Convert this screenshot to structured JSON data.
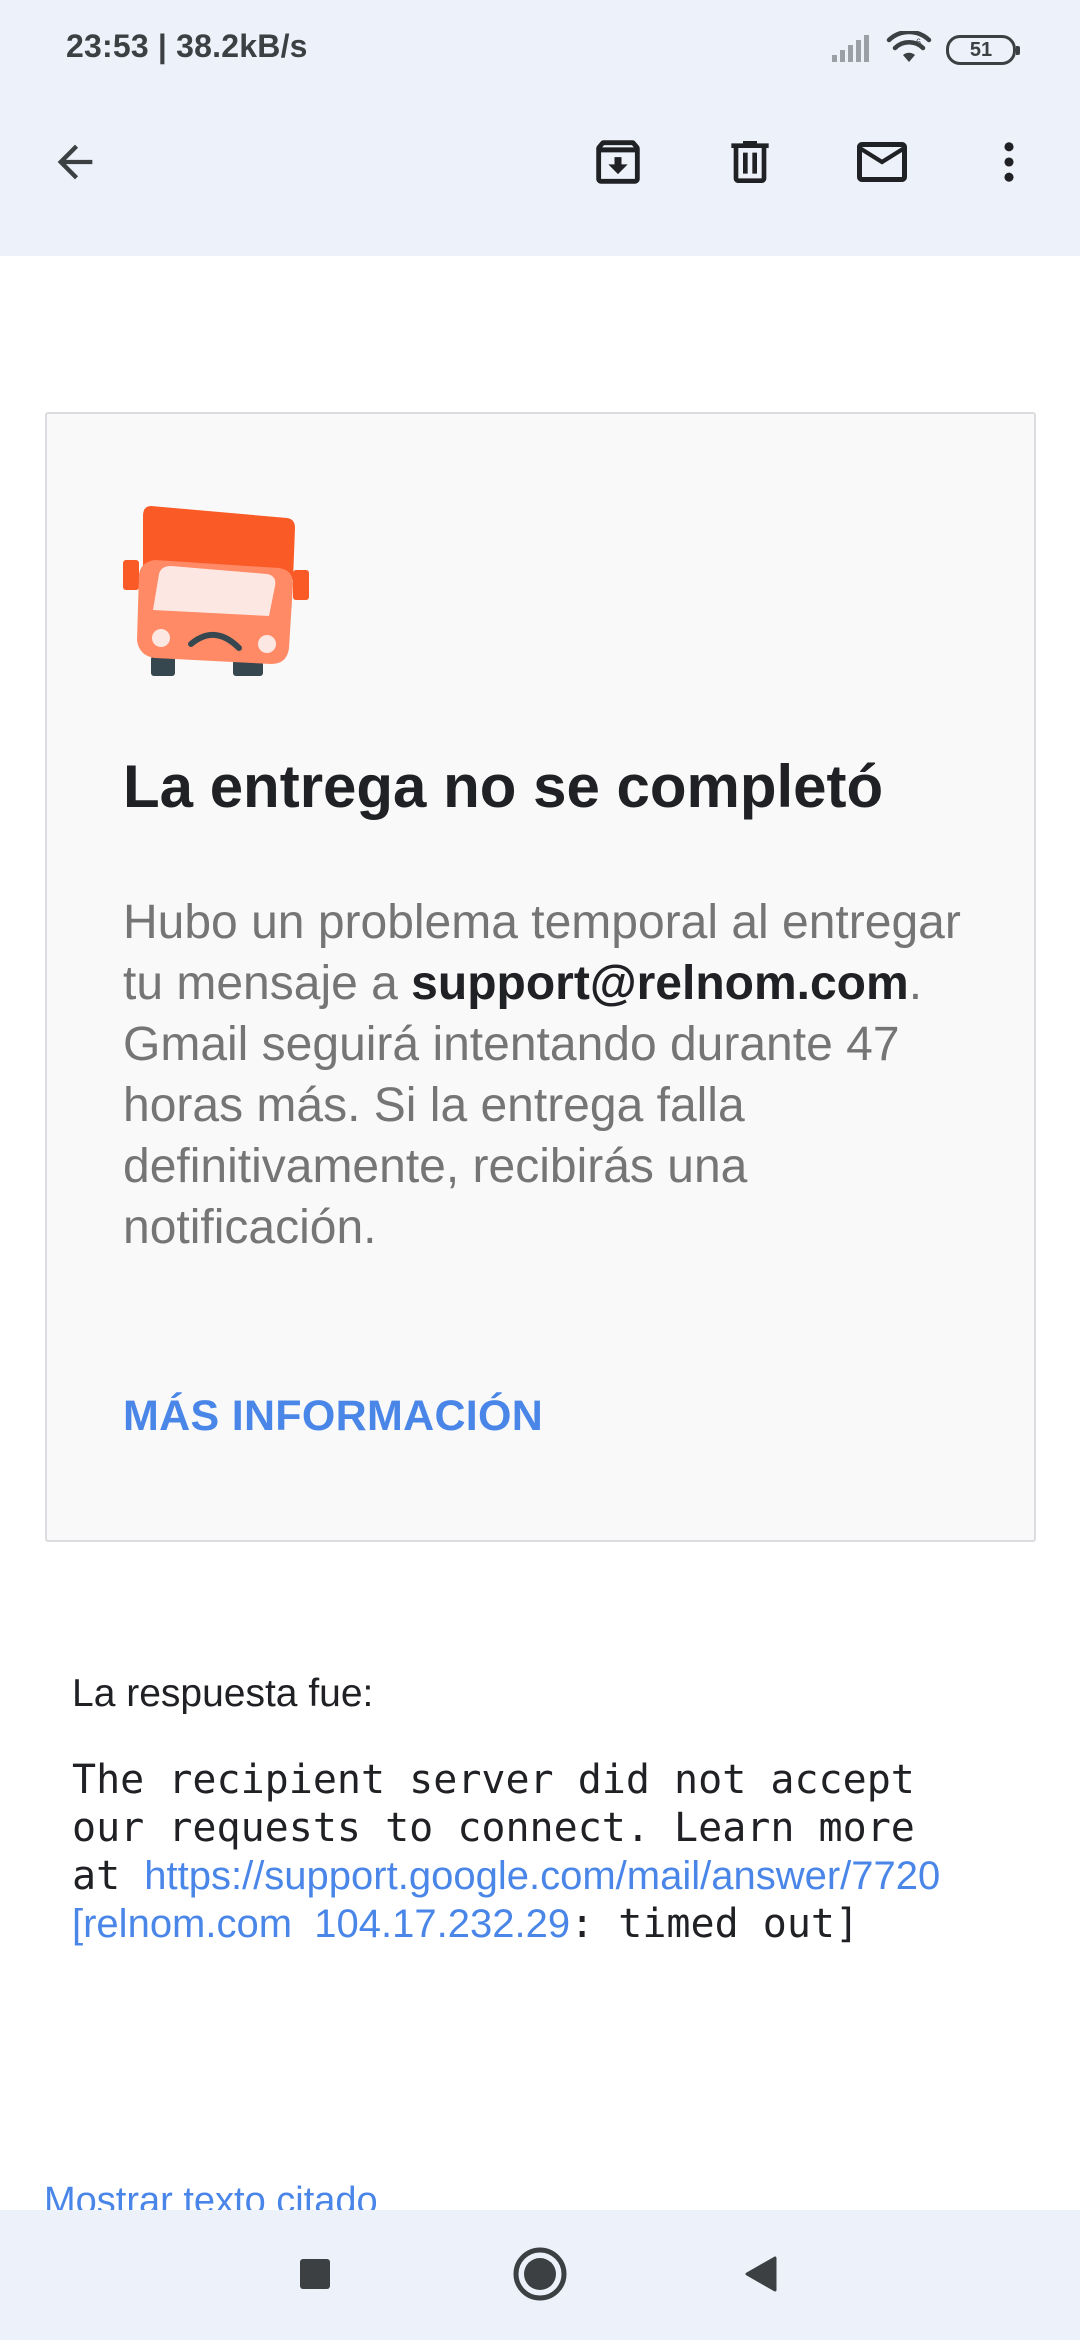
{
  "status_bar": {
    "time": "23:53 | 38.2kB/s",
    "battery": "51"
  },
  "toolbar": {
    "back_icon": "arrow-back-icon",
    "archive_icon": "archive-icon",
    "delete_icon": "trash-icon",
    "mark_unread_icon": "mail-icon",
    "more_icon": "more-vert-icon"
  },
  "card": {
    "icon": "sad-truck-icon",
    "title": "La entrega no se completó",
    "body_before": "Hubo un problema temporal al entregar tu mensaje a ",
    "recipient": "support@relnom.com",
    "body_after": ". Gmail seguirá intentando durante 47 horas más. Si la entrega falla definitivamente, recibirás una notificación.",
    "link": "MÁS INFORMACIÓN"
  },
  "response": {
    "label": "La respuesta fue:",
    "line1": "The recipient server did not accept",
    "line2": "our requests to connect. Learn more",
    "line3_prefix": "at ",
    "line3_link": "https://support.google.com/mail/answer/7720",
    "line4_link": "[relnom.com  104.17.232.29",
    "line4_suffix": ": timed out]"
  },
  "footer": {
    "show_quoted": "Mostrar texto citado"
  },
  "nav_bar": {
    "recents_icon": "square-icon",
    "home_icon": "circle-icon",
    "back_icon": "triangle-back-icon"
  },
  "colors": {
    "accent": "#4a86e8",
    "bar_background": "#edf2fa",
    "truck": "#fa5a26"
  }
}
